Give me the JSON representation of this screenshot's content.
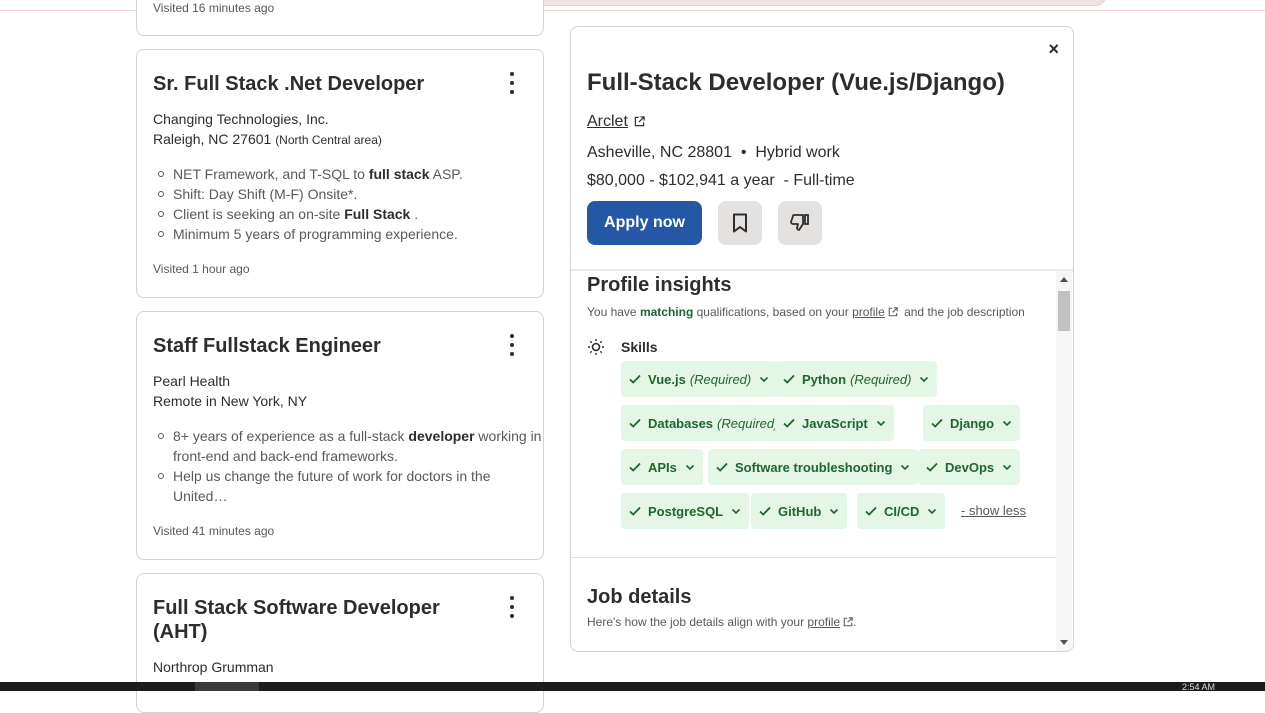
{
  "partial_card_visited": "Visited 16 minutes ago",
  "cards": [
    {
      "title": "Sr. Full Stack .Net Developer",
      "company": "Changing Technologies, Inc.",
      "location": "Raleigh, NC 27601",
      "location_note": "(North Central area)",
      "bullets": [
        {
          "pre": "NET Framework, and T-SQL to ",
          "bold": "full stack",
          "post": " ASP."
        },
        {
          "pre": "Shift: Day Shift (M-F) Onsite*.",
          "bold": "",
          "post": ""
        },
        {
          "pre": "Client is seeking an on-site ",
          "bold": "Full Stack",
          "post": " ."
        },
        {
          "pre": "Minimum 5 years of programming experience.",
          "bold": "",
          "post": ""
        }
      ],
      "visited": "Visited 1 hour ago"
    },
    {
      "title": "Staff Fullstack Engineer",
      "company": "Pearl Health",
      "location": "Remote in New York, NY",
      "bullets": [
        {
          "pre": "8+ years of experience as a full-stack ",
          "bold": "developer",
          "post": " working in front-end and back-end frameworks."
        },
        {
          "pre": "Help us change the future of work for doctors in the United…",
          "bold": "",
          "post": ""
        }
      ],
      "visited": "Visited 41 minutes ago"
    },
    {
      "title": "Full Stack Software Developer (AHT)",
      "company": "Northrop Grumman"
    }
  ],
  "detail": {
    "close": "×",
    "title": "Full-Stack Developer (Vue.js/Django)",
    "company": "Arclet",
    "location": "Asheville, NC 28801",
    "separator": "•",
    "work_type": "Hybrid work",
    "salary": "$80,000 - $102,941 a year",
    "job_type": "- Full-time",
    "apply_label": "Apply now",
    "profile_insights": {
      "title": "Profile insights",
      "sub_pre": "You have ",
      "sub_bold": "matching",
      "sub_mid": " qualifications, based on your ",
      "sub_link": "profile",
      "sub_post": " and the job description",
      "skills_label": "Skills",
      "skills": [
        {
          "name": "Vue.js",
          "req": "(Required)"
        },
        {
          "name": "Python",
          "req": "(Required)"
        },
        {
          "name": "Databases",
          "req": "(Required)"
        },
        {
          "name": "JavaScript",
          "req": ""
        },
        {
          "name": "Django",
          "req": ""
        },
        {
          "name": "APIs",
          "req": ""
        },
        {
          "name": "Software troubleshooting",
          "req": ""
        },
        {
          "name": "DevOps",
          "req": ""
        },
        {
          "name": "PostgreSQL",
          "req": ""
        },
        {
          "name": "GitHub",
          "req": ""
        },
        {
          "name": "CI/CD",
          "req": ""
        }
      ],
      "show_less": "- show less"
    },
    "job_details": {
      "title": "Job details",
      "sub_pre": "Here's how the job details align with your ",
      "sub_link": "profile",
      "sub_post": "."
    }
  },
  "taskbar": {
    "clock": "2:54 AM"
  },
  "colors": {
    "accent": "#2557a7",
    "match_green": "#1f662c",
    "chip_bg": "#e4f7e6"
  }
}
